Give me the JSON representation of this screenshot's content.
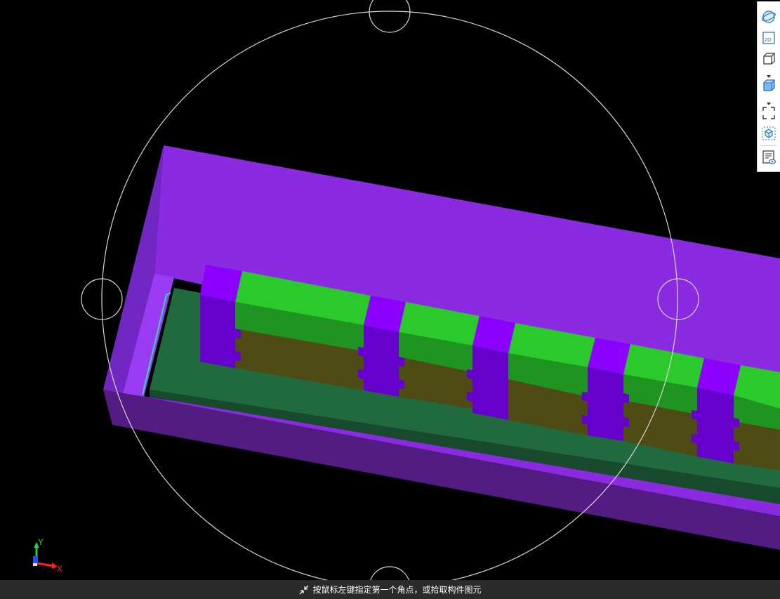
{
  "viewport": {
    "background": "#000000",
    "colors": {
      "casing_top": "#8a2be2",
      "casing_side": "#7b25c9",
      "casing_front": "#521c82",
      "casing_inner": "#9b3cf5",
      "block_top": "#2bc92b",
      "block_front": "#1f9420",
      "block_lower": "#4f4b15",
      "separator_top": "#8b00ff",
      "separator_front": "#6600cc",
      "slab": "#216a3f",
      "slab_edge": "#184a2d",
      "highlight_line": "#37d6a8",
      "navigation_ring": "#d8d8d8"
    }
  },
  "toolbar": {
    "items": [
      {
        "icon": "orbit-icon"
      },
      {
        "icon": "2d-view-icon",
        "label": "2D"
      },
      {
        "icon": "box-view-icon"
      },
      {
        "icon": "dropdown-caret-icon"
      },
      {
        "icon": "shaded-box-icon"
      },
      {
        "icon": "dropdown-caret-icon"
      },
      {
        "icon": "zoom-extents-icon"
      },
      {
        "icon": "3d-cube-icon"
      },
      {
        "icon": "layer-visibility-icon"
      }
    ]
  },
  "axis": {
    "y_label": "Y",
    "x_label": "X",
    "y_color": "#2ecc40",
    "x_color": "#ff2020",
    "z_color": "#2050ff"
  },
  "status": {
    "icon": "shrink-arrows-icon",
    "message": "按鼠标左键指定第一个角点，或拾取构件图元"
  }
}
